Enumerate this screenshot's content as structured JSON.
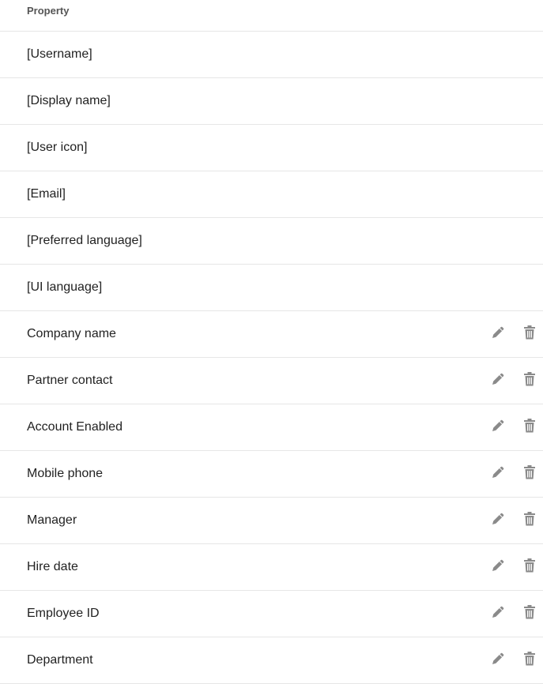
{
  "header": {
    "property_label": "Property"
  },
  "rows": [
    {
      "label": "[Username]",
      "editable": false
    },
    {
      "label": "[Display name]",
      "editable": false
    },
    {
      "label": "[User icon]",
      "editable": false
    },
    {
      "label": "[Email]",
      "editable": false
    },
    {
      "label": "[Preferred language]",
      "editable": false
    },
    {
      "label": "[UI language]",
      "editable": false
    },
    {
      "label": "Company name",
      "editable": true
    },
    {
      "label": "Partner contact",
      "editable": true
    },
    {
      "label": "Account Enabled",
      "editable": true
    },
    {
      "label": "Mobile phone",
      "editable": true
    },
    {
      "label": "Manager",
      "editable": true
    },
    {
      "label": "Hire date",
      "editable": true
    },
    {
      "label": "Employee ID",
      "editable": true
    },
    {
      "label": "Department",
      "editable": true
    }
  ],
  "icons": {
    "edit": "pencil-icon",
    "delete": "trash-icon"
  },
  "colors": {
    "icon": "#8a8a8a",
    "divider": "#e6e6e6",
    "text": "#222222"
  }
}
